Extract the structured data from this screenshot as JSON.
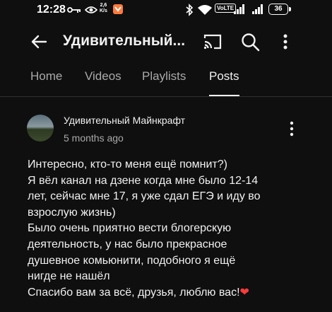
{
  "status_bar": {
    "time": "12:28",
    "speed_top": "2,6",
    "speed_bottom": "K/s",
    "volte": "VoLTE",
    "battery": "36",
    "app_icon_color": "#ff7a3c"
  },
  "app_bar": {
    "title": "Удивительный..."
  },
  "tabs": [
    {
      "label": "Home"
    },
    {
      "label": "Videos"
    },
    {
      "label": "Playlists"
    },
    {
      "label": "Posts",
      "active": true
    }
  ],
  "post": {
    "author": "Удивительный Майнкрафт",
    "time_ago": "5 months ago",
    "lines": [
      "Интересно, кто-то меня ещё помнит?)",
      "Я вёл канал на дзене когда мне было 12-14",
      "лет, сейчас мне 17, я уже сдал ЕГЭ и иду во",
      "взрослую жизнь)",
      "Было очень приятно вести блогерскую",
      "деятельность, у нас было прекрасное",
      "душевное комьюнити, подобного я ещё",
      "нигде не нашёл",
      "Спасибо вам за всё, друзья, люблю вас!"
    ],
    "emoji": "❤"
  },
  "colors": {
    "background": "#0f0f0f",
    "text": "#f1f1f1",
    "secondary_text": "#aaaaaa",
    "heart": "#ff3b3b"
  }
}
